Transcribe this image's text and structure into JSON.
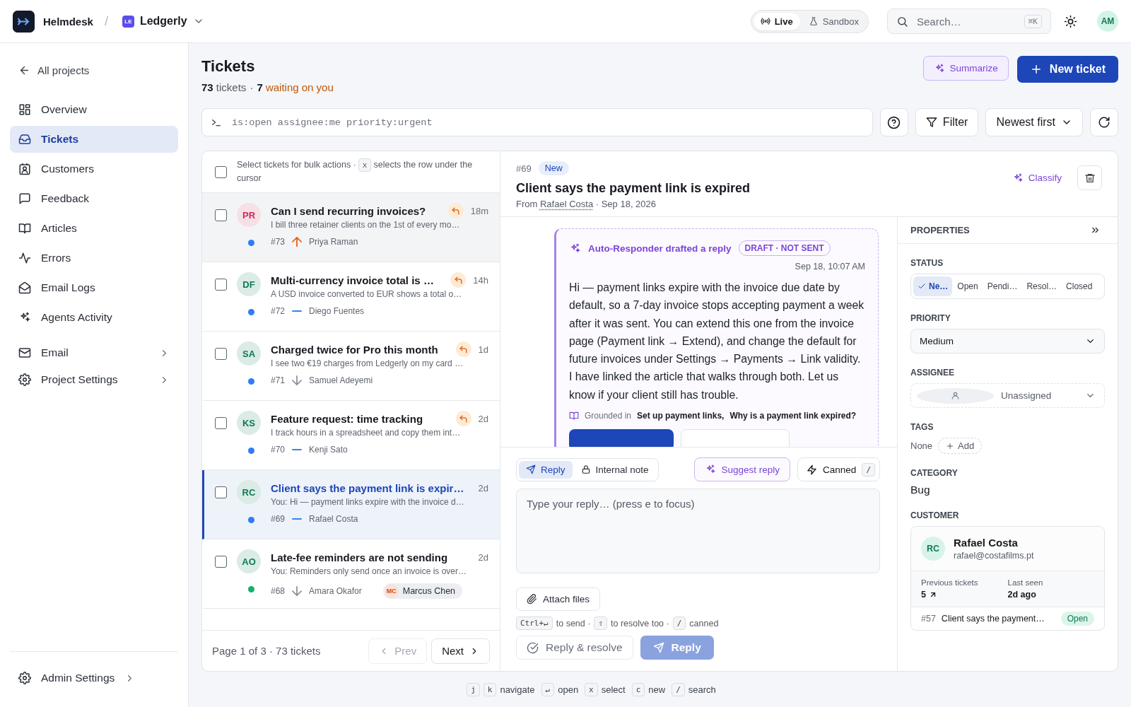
{
  "topbar": {
    "brand": "Helmdesk",
    "separator": "/",
    "project": {
      "badge": "LE",
      "name": "Ledgerly"
    },
    "environments": [
      {
        "label": "Live",
        "selected": true
      },
      {
        "label": "Sandbox",
        "selected": false
      }
    ],
    "search": {
      "placeholder": "Search…",
      "shortcut": "⌘K"
    },
    "user_initials": "AM"
  },
  "sidebar": {
    "back": "All projects",
    "items": [
      {
        "label": "Overview",
        "selected": false
      },
      {
        "label": "Tickets",
        "selected": true
      },
      {
        "label": "Customers",
        "selected": false
      },
      {
        "label": "Feedback",
        "selected": false
      },
      {
        "label": "Articles",
        "selected": false
      },
      {
        "label": "Errors",
        "selected": false
      },
      {
        "label": "Email Logs",
        "selected": false
      },
      {
        "label": "Agents Activity",
        "selected": false
      }
    ],
    "groups": [
      {
        "label": "Email",
        "expanded": false
      },
      {
        "label": "Project Settings",
        "expanded": false
      }
    ],
    "footer": {
      "label": "Admin Settings"
    }
  },
  "header": {
    "title": "Tickets",
    "count": "73",
    "count_label": "tickets",
    "separator": "·",
    "waiting_count": "7",
    "waiting_label": "waiting on you",
    "summarize": "Summarize",
    "new_ticket": "New ticket"
  },
  "toolbar": {
    "query": "is:open assignee:me priority:urgent",
    "filter": "Filter",
    "sort": "Newest first"
  },
  "list": {
    "hint_before": "Select tickets for bulk actions ·",
    "hint_key": "x",
    "hint_after": "selects the row under the cursor",
    "all_checked": false,
    "tickets": [
      {
        "title": "Can I send recurring invoices?",
        "preview": "I bill three retainer clients on the 1st of every mo…",
        "time": "18m",
        "number": "#73",
        "priority": {
          "kind": "up"
        },
        "customer": "Priya Raman",
        "avatar": {
          "initials": "PR",
          "color": "#c92a5a"
        },
        "dot": {
          "color": "#2f7cf6"
        },
        "awaiting_reply": true,
        "checked": false,
        "selected": false,
        "cursor": true
      },
      {
        "title": "Multi-currency invoice total is …",
        "preview": "A USD invoice converted to EUR shows a total o…",
        "time": "14h",
        "number": "#72",
        "priority": {
          "kind": "none"
        },
        "customer": "Diego Fuentes",
        "avatar": {
          "initials": "DF",
          "color": "#0e7a55"
        },
        "dot": {
          "color": "#2f7cf6"
        },
        "awaiting_reply": true,
        "checked": false,
        "selected": false,
        "cursor": false
      },
      {
        "title": "Charged twice for Pro this month",
        "preview": "I see two €19 charges from Ledgerly on my card …",
        "time": "1d",
        "number": "#71",
        "priority": {
          "kind": "down"
        },
        "customer": "Samuel Adeyemi",
        "avatar": {
          "initials": "SA",
          "color": "#0e7a55"
        },
        "dot": {
          "color": "#2f7cf6"
        },
        "awaiting_reply": true,
        "checked": false,
        "selected": false,
        "cursor": false
      },
      {
        "title": "Feature request: time tracking",
        "preview": "I track hours in a spreadsheet and copy them int…",
        "time": "2d",
        "number": "#70",
        "priority": {
          "kind": "none"
        },
        "customer": "Kenji Sato",
        "avatar": {
          "initials": "KS",
          "color": "#0e7a55"
        },
        "dot": {
          "color": "#2f7cf6"
        },
        "awaiting_reply": true,
        "checked": false,
        "selected": false,
        "cursor": false
      },
      {
        "title": "Client says the payment link is expir…",
        "preview": "You: Hi — payment links expire with the invoice d…",
        "time": "2d",
        "number": "#69",
        "priority": {
          "kind": "none"
        },
        "customer": "Rafael Costa",
        "avatar": {
          "initials": "RC",
          "color": "#0e7a55"
        },
        "dot": {
          "color": "#2f7cf6"
        },
        "awaiting_reply": false,
        "checked": false,
        "selected": true,
        "cursor": false
      },
      {
        "title": "Late-fee reminders are not sending",
        "preview": "You: Reminders only send once an invoice is over…",
        "time": "2d",
        "number": "#68",
        "priority": {
          "kind": "down"
        },
        "customer": "Amara Okafor",
        "avatar": {
          "initials": "AO",
          "color": "#0e7a55"
        },
        "dot": {
          "color": "#16b06a"
        },
        "awaiting_reply": false,
        "checked": false,
        "selected": false,
        "cursor": false,
        "assignee": {
          "initials": "MC",
          "name": "Marcus Chen"
        }
      }
    ],
    "pager": {
      "summary": "Page 1 of 3 · 73 tickets",
      "prev": "Prev",
      "prev_disabled": true,
      "next": "Next"
    }
  },
  "detail": {
    "number": "#69",
    "status": "New",
    "title": "Client says the payment link is expired",
    "from_label": "From",
    "author": "Rafael Costa",
    "date": "· Sep 18, 2026",
    "classify": "Classify"
  },
  "draft": {
    "agent": "Auto-Responder drafted a reply",
    "badge": "DRAFT · NOT SENT",
    "time": "Sep 18, 10:07 AM",
    "body": "Hi — payment links expire with the invoice due date by default, so a 7-day invoice stops accepting payment a week after it was sent. You can extend this one from the invoice page (Payment link → Extend), and change the default for future invoices under Settings → Payments → Link validity. I have linked the article that walks through both. Let us know if your client still has trouble.",
    "grounded_label": "Grounded in",
    "sources": [
      "Set up payment links,",
      "Why is a payment link expired?"
    ]
  },
  "composer": {
    "modes": [
      {
        "label": "Reply",
        "selected": true
      },
      {
        "label": "Internal note",
        "selected": false
      }
    ],
    "suggest": "Suggest reply",
    "canned": "Canned",
    "canned_key": "/",
    "placeholder": "Type your reply… (press e to focus)",
    "attach": "Attach files",
    "hints": [
      {
        "key": "Ctrl+↵",
        "text": "to send ·"
      },
      {
        "key": "⇧",
        "text": "to resolve too ·"
      },
      {
        "key": "/",
        "text": "canned"
      }
    ],
    "resolve": "Reply & resolve",
    "send": "Reply",
    "send_disabled": true
  },
  "properties": {
    "title": "PROPERTIES",
    "status_label": "STATUS",
    "status_options": [
      {
        "label": "Ne…",
        "selected": true
      },
      {
        "label": "Open",
        "selected": false
      },
      {
        "label": "Pendi…",
        "selected": false
      },
      {
        "label": "Resol…",
        "selected": false
      },
      {
        "label": "Closed",
        "selected": false
      }
    ],
    "priority_label": "PRIORITY",
    "priority": "Medium",
    "assignee_label": "ASSIGNEE",
    "assignee_placeholder": "Unassigned",
    "tags_label": "TAGS",
    "tags_empty": "None",
    "add_tag": "Add",
    "category_label": "CATEGORY",
    "category": "Bug",
    "customer_label": "CUSTOMER",
    "customer": {
      "initials": "RC",
      "name": "Rafael Costa",
      "email": "rafael@costafilms.pt",
      "stats": [
        {
          "label": "Previous tickets",
          "value": "5",
          "link": true
        },
        {
          "label": "Last seen",
          "value": "2d ago",
          "link": false
        }
      ],
      "recent": [
        {
          "number": "#57",
          "title": "Client says the payment…",
          "status": "Open"
        }
      ]
    }
  },
  "shortcuts": [
    {
      "keys": [
        "j",
        "k"
      ],
      "label": "navigate"
    },
    {
      "keys": [
        "↵"
      ],
      "label": "open"
    },
    {
      "keys": [
        "x"
      ],
      "label": "select"
    },
    {
      "keys": [
        "c"
      ],
      "label": "new"
    },
    {
      "keys": [
        "/"
      ],
      "label": "search"
    }
  ]
}
